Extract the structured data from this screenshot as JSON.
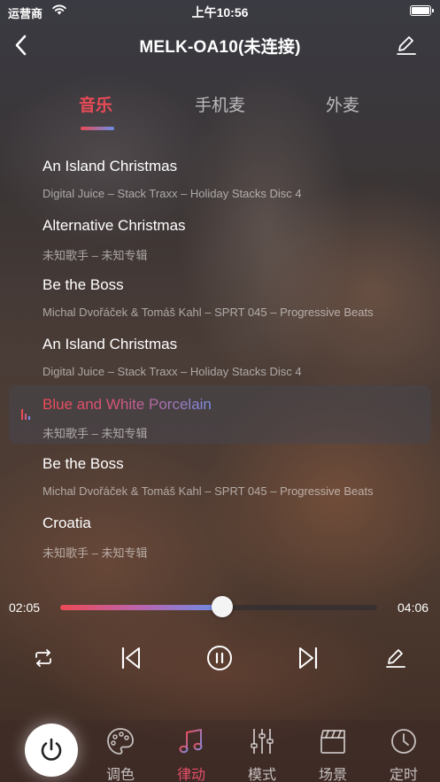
{
  "status_bar": {
    "carrier": "运营商",
    "time": "上午10:56"
  },
  "nav": {
    "title": "MELK-OA10(未连接)"
  },
  "tabs": [
    {
      "label": "音乐",
      "active": true
    },
    {
      "label": "手机麦",
      "active": false
    },
    {
      "label": "外麦",
      "active": false
    }
  ],
  "songs": [
    {
      "title": "An Island Christmas",
      "subtitle": "Digital Juice – Stack Traxx – Holiday Stacks Disc 4"
    },
    {
      "title": "Alternative Christmas",
      "subtitle": "未知歌手 – 未知专辑"
    },
    {
      "title": "Be the Boss",
      "subtitle": "Michal Dvořáček & Tomáš Kahl – SPRT 045 – Progressive Beats"
    },
    {
      "title": "An Island Christmas",
      "subtitle": "Digital Juice – Stack Traxx – Holiday Stacks Disc 4"
    },
    {
      "title": "Blue and White Porcelain",
      "subtitle": "未知歌手 – 未知专辑",
      "playing": true
    },
    {
      "title": "Be the Boss",
      "subtitle": "Michal Dvořáček & Tomáš Kahl – SPRT 045 – Progressive Beats"
    },
    {
      "title": "Croatia",
      "subtitle": "未知歌手 – 未知专辑"
    }
  ],
  "player": {
    "current_time": "02:05",
    "total_time": "04:06",
    "progress": 0.51
  },
  "bottom_tabs": [
    {
      "label": "调色",
      "icon": "palette-icon",
      "active": false
    },
    {
      "label": "律动",
      "icon": "music-note-icon",
      "active": true
    },
    {
      "label": "模式",
      "icon": "equalizer-icon",
      "active": false
    },
    {
      "label": "场景",
      "icon": "clapperboard-icon",
      "active": false
    },
    {
      "label": "定时",
      "icon": "clock-icon",
      "active": false
    }
  ],
  "colors": {
    "accent_red": "#e94b57",
    "accent_blue": "#6a8ee6",
    "active_tab": "#e6506a"
  }
}
